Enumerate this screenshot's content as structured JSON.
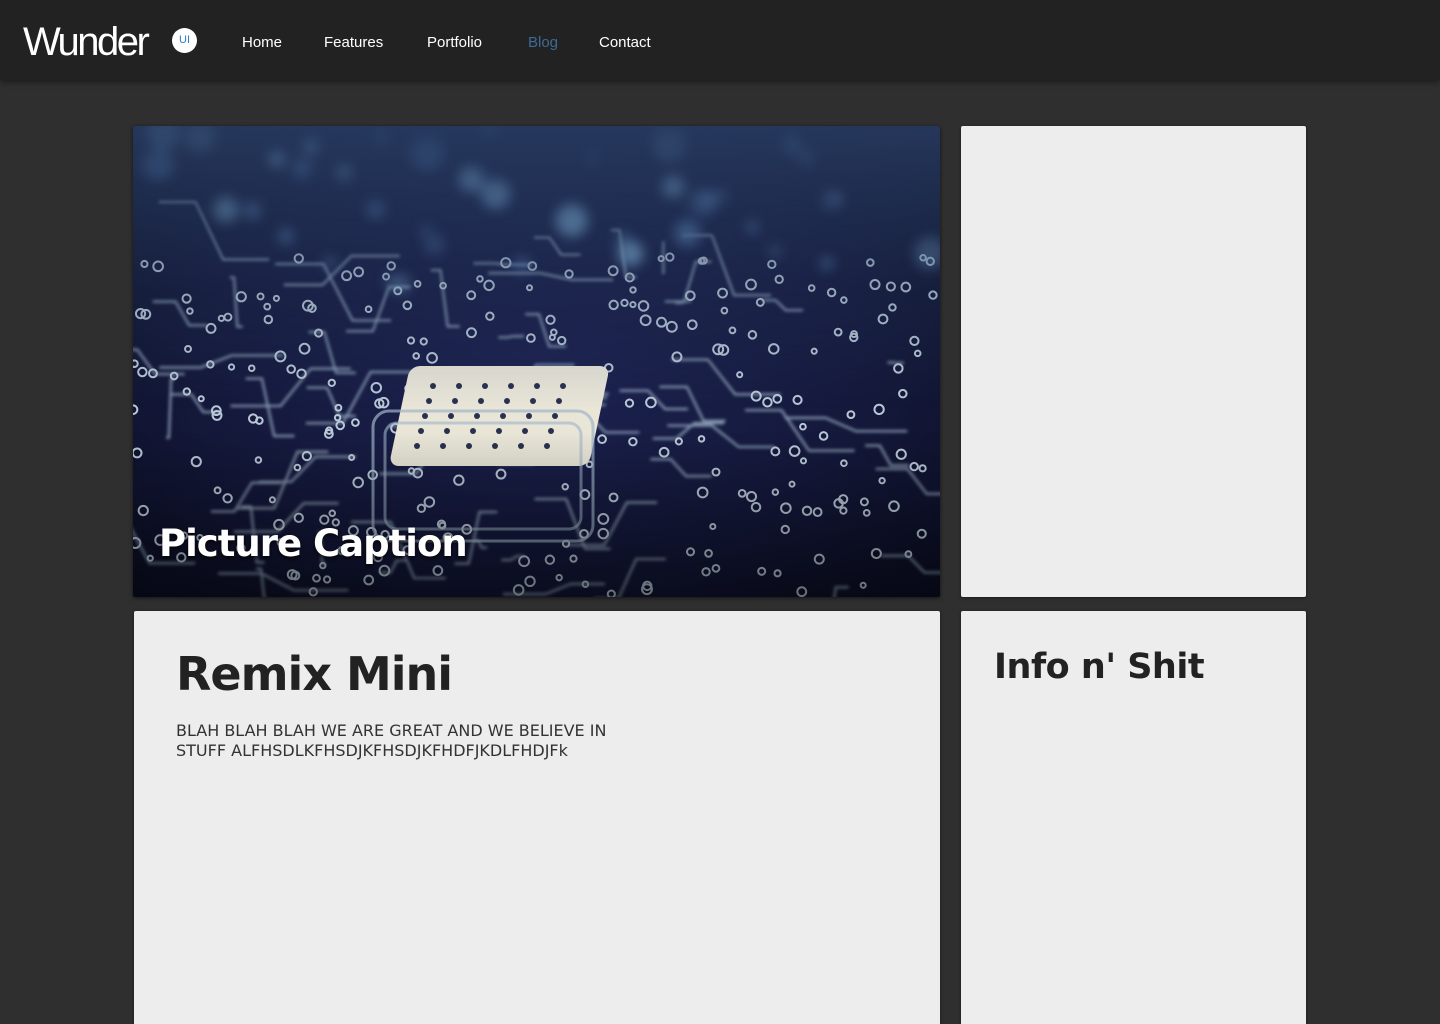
{
  "navbar": {
    "brand": "Wunder",
    "badge": "UI",
    "items": [
      {
        "label": "Home"
      },
      {
        "label": "Features"
      },
      {
        "label": "Portfolio"
      },
      {
        "label": "Blog",
        "active": true
      },
      {
        "label": "Contact"
      }
    ]
  },
  "hero": {
    "image": "circuit-board-photo",
    "caption": "Picture Caption"
  },
  "main": {
    "title": "Remix Mini",
    "body": "BLAH BLAH BLAH WE ARE GREAT AND WE BELIEVE IN STUFF ALFHSDLKFHSDJKFHSDJKFHDFJKDLFHDJFk"
  },
  "sidebar": {
    "title": "Info n' Shit"
  },
  "colors": {
    "page_bg": "#2f2f2f",
    "navbar_bg": "#222222",
    "card_bg": "#ededed",
    "active_nav": "#3d6b94",
    "badge_text": "#2f7dc0"
  }
}
